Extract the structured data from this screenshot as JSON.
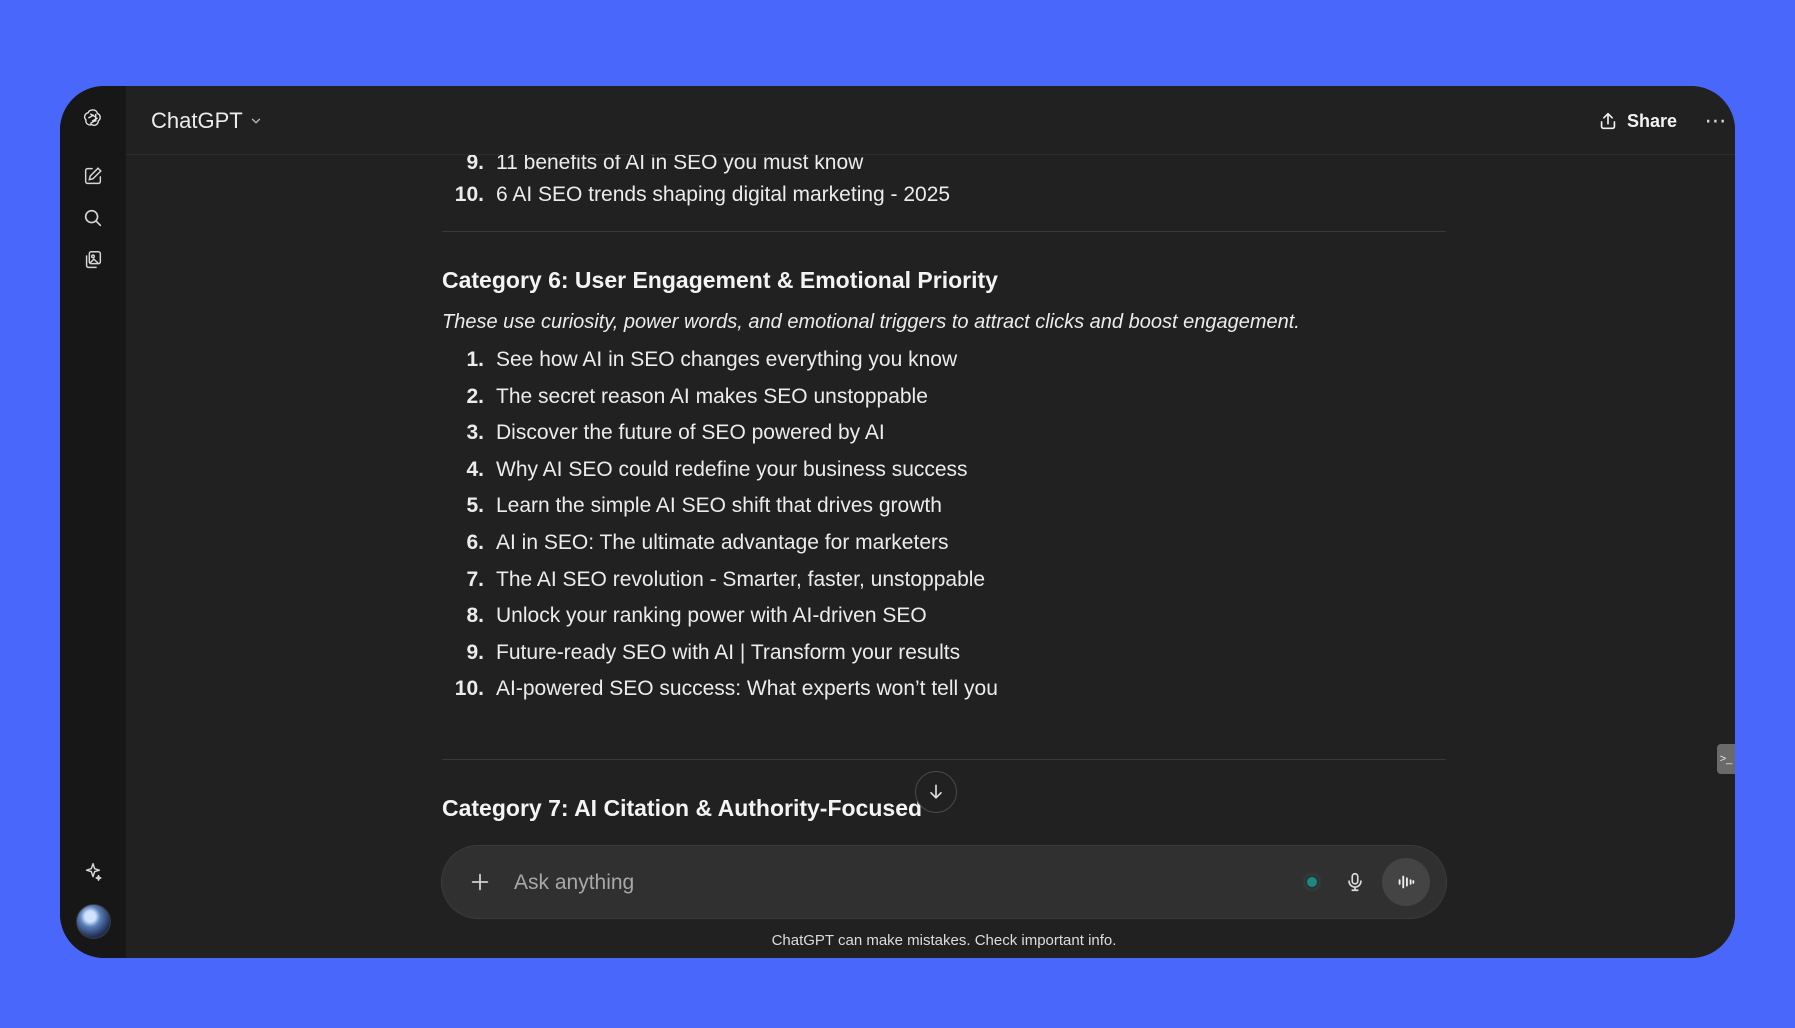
{
  "app": {
    "model_name": "ChatGPT",
    "share_label": "Share",
    "more_label": "⋯"
  },
  "rail": {
    "icons": [
      "openai-logo-icon",
      "new-chat-icon",
      "search-icon",
      "library-icon",
      "sparkle-icon",
      "avatar"
    ]
  },
  "conversation": {
    "prev_list": [
      {
        "num": "9.",
        "text": "11 benefits of AI in SEO you must know"
      },
      {
        "num": "10.",
        "text": "6 AI SEO trends shaping digital marketing - 2025"
      }
    ],
    "category6": {
      "heading": "Category 6: User Engagement & Emotional Priority",
      "intro": "These use curiosity, power words, and emotional triggers to attract clicks and boost engagement.",
      "items": [
        {
          "num": "1.",
          "text": "See how AI in SEO changes everything you know"
        },
        {
          "num": "2.",
          "text": "The secret reason AI makes SEO unstoppable"
        },
        {
          "num": "3.",
          "text": "Discover the future of SEO powered by AI"
        },
        {
          "num": "4.",
          "text": "Why AI SEO could redefine your business success"
        },
        {
          "num": "5.",
          "text": "Learn the simple AI SEO shift that drives growth"
        },
        {
          "num": "6.",
          "text": "AI in SEO: The ultimate advantage for marketers"
        },
        {
          "num": "7.",
          "text": "The AI SEO revolution - Smarter, faster, unstoppable"
        },
        {
          "num": "8.",
          "text": "Unlock your ranking power with AI-driven SEO"
        },
        {
          "num": "9.",
          "text": "Future-ready SEO with AI | Transform your results"
        },
        {
          "num": "10.",
          "text": "AI-powered SEO success: What experts won’t tell you"
        }
      ]
    },
    "category7": {
      "heading": "Category 7: AI Citation & Authority-Focused"
    }
  },
  "composer": {
    "placeholder": "Ask anything"
  },
  "footer": {
    "disclaimer": "ChatGPT can make mistakes. Check important info."
  },
  "colors": {
    "frame": "#4a67fc",
    "window": "#212121",
    "rail": "#171717",
    "composer": "#303030",
    "text": "#ececec",
    "status_dot": "#1a8a80"
  }
}
